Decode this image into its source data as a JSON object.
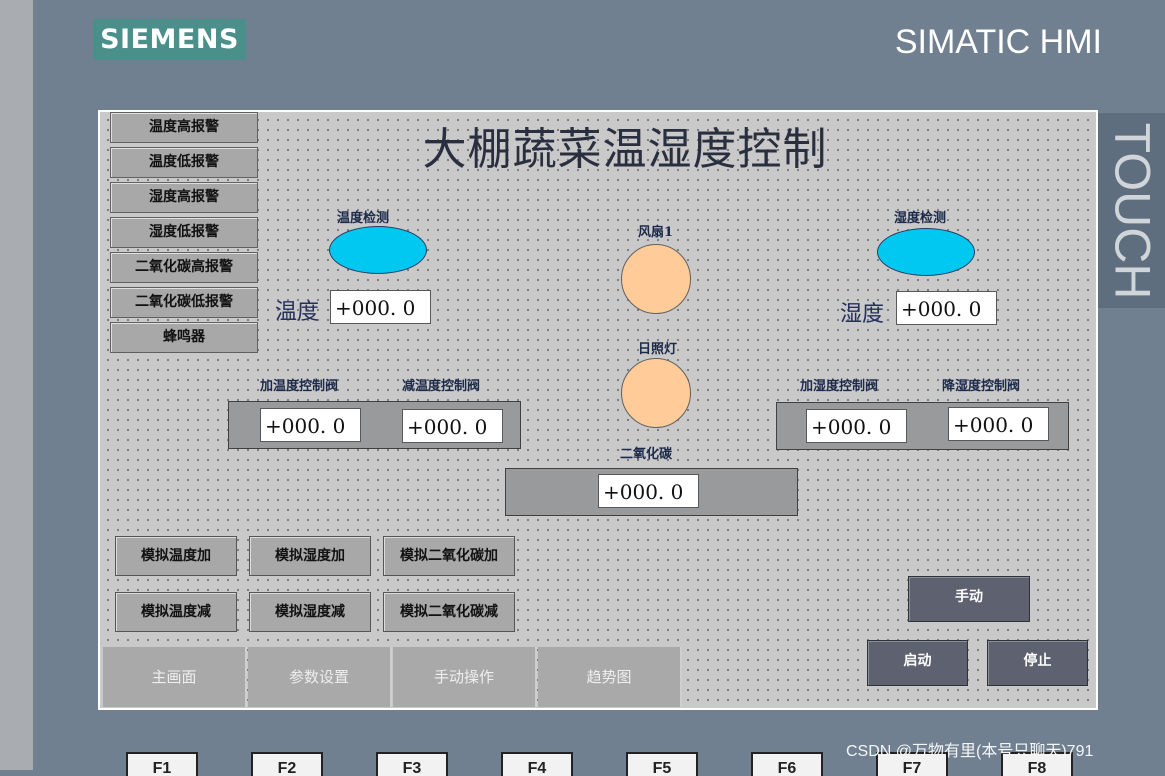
{
  "device": {
    "brand": "SIEMENS",
    "model": "SIMATIC HMI",
    "side_label": "TOUCH",
    "function_keys": [
      "F1",
      "F2",
      "F3",
      "F4",
      "F5",
      "F6",
      "F7",
      "F8"
    ]
  },
  "screen": {
    "title": "大棚蔬菜温湿度控制",
    "alarm_buttons": [
      "温度高报警",
      "温度低报警",
      "湿度高报警",
      "湿度低报警",
      "二氧化碳高报警",
      "二氧化碳低报警",
      "蜂鸣器"
    ],
    "temperature": {
      "detect_label": "温度检测",
      "value_label": "温度",
      "value": "+000. 0",
      "heat_valve_label": "加温度控制阀",
      "heat_valve_value": "+000. 0",
      "cool_valve_label": "减温度控制阀",
      "cool_valve_value": "+000. 0",
      "indicator_color": "#00c8f0"
    },
    "humidity": {
      "detect_label": "湿度检测",
      "value_label": "湿度",
      "value": "+000. 0",
      "add_valve_label": "加湿度控制阀",
      "add_valve_value": "+000. 0",
      "reduce_valve_label": "降湿度控制阀",
      "reduce_valve_value": "+000. 0",
      "indicator_color": "#00c8f0"
    },
    "fan": {
      "label": "风扇1",
      "indicator_color": "#ffcc99"
    },
    "sunlight": {
      "label": "日照灯",
      "indicator_color": "#ffcc99"
    },
    "co2": {
      "label": "二氧化碳",
      "value": "+000. 0"
    },
    "sim_buttons": {
      "temp_up": "模拟温度加",
      "hum_up": "模拟湿度加",
      "co2_up": "模拟二氧化碳加",
      "temp_down": "模拟温度减",
      "hum_down": "模拟湿度减",
      "co2_down": "模拟二氧化碳减"
    },
    "controls": {
      "manual": "手动",
      "start": "启动",
      "stop": "停止"
    },
    "nav_tabs": [
      "主画面",
      "参数设置",
      "手动操作",
      "趋势图"
    ]
  },
  "watermark": "CSDN @万物有里(本号只聊天)791"
}
